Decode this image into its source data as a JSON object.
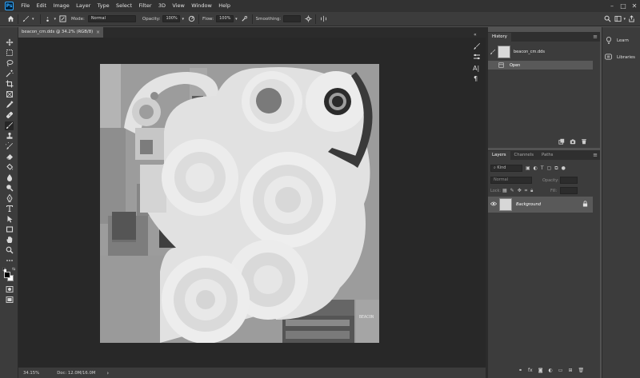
{
  "menubar": {
    "items": [
      "File",
      "Edit",
      "Image",
      "Layer",
      "Type",
      "Select",
      "Filter",
      "3D",
      "View",
      "Window",
      "Help"
    ],
    "logo": "Ps"
  },
  "options": {
    "mode_label": "Mode:",
    "mode_value": "Normal",
    "opacity_label": "Opacity:",
    "opacity_value": "100%",
    "flow_label": "Flow:",
    "flow_value": "100%",
    "smoothing_label": "Smoothing:",
    "smoothing_value": ""
  },
  "document": {
    "tab_title": "beacon_cm.dds @ 34.2% (RGB/8)",
    "close_glyph": "×",
    "texture_label": "BEACON"
  },
  "status": {
    "zoom": "34.15%",
    "doc_info": "Doc: 12.0M/16.0M",
    "arrow": "›"
  },
  "history": {
    "tabs": [
      "History"
    ],
    "snapshot_name": "beacon_cm.dds",
    "states": [
      "Open"
    ]
  },
  "layers": {
    "tabs": [
      "Layers",
      "Channels",
      "Paths"
    ],
    "kind_placeholder": "Kind",
    "blend_mode": "Normal",
    "opacity_label": "Opacity:",
    "lock_label": "Lock:",
    "fill_label": "Fill:",
    "layer_name": "Background"
  },
  "right_column": {
    "learn_label": "Learn",
    "libraries_label": "Libraries"
  },
  "colors": {
    "accent": "#31a8ff",
    "canvas_bg": "#282828",
    "panel_bg": "#3c3c3c"
  }
}
